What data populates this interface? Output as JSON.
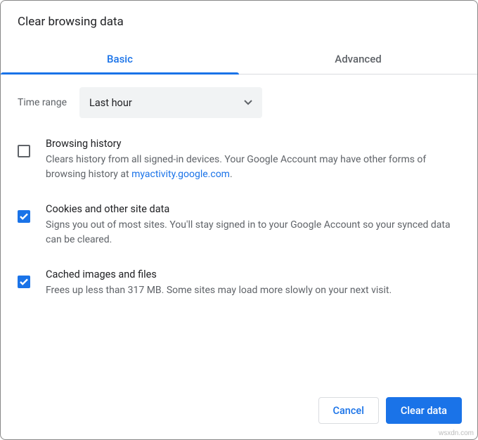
{
  "title": "Clear browsing data",
  "tabs": {
    "basic": "Basic",
    "advanced": "Advanced"
  },
  "time_range": {
    "label": "Time range",
    "value": "Last hour"
  },
  "options": {
    "browsing_history": {
      "title": "Browsing history",
      "desc_before": "Clears history from all signed-in devices. Your Google Account may have other forms of browsing history at ",
      "link_text": "myactivity.google.com",
      "desc_after": ".",
      "checked": false
    },
    "cookies": {
      "title": "Cookies and other site data",
      "desc": "Signs you out of most sites. You'll stay signed in to your Google Account so your synced data can be cleared.",
      "checked": true
    },
    "cache": {
      "title": "Cached images and files",
      "desc": "Frees up less than 317 MB. Some sites may load more slowly on your next visit.",
      "checked": true
    }
  },
  "buttons": {
    "cancel": "Cancel",
    "clear": "Clear data"
  },
  "watermark": "wsxdn.com"
}
